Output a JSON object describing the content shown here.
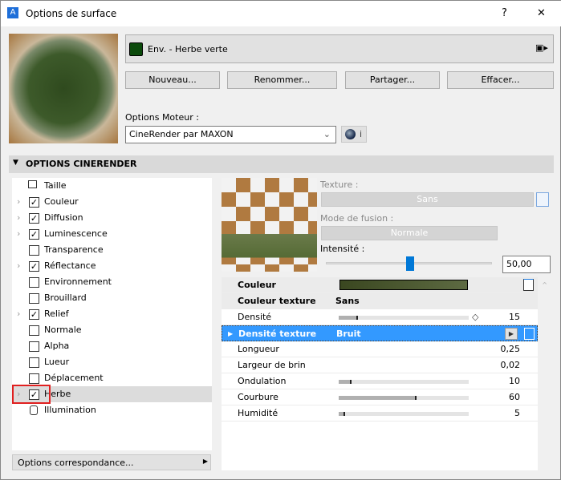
{
  "window": {
    "title": "Options de surface",
    "help": "?",
    "close": "✕"
  },
  "material": {
    "name": "Env. - Herbe verte",
    "swatch": "#0b4a0b"
  },
  "buttons": {
    "new": "Nouveau...",
    "rename": "Renommer...",
    "share": "Partager...",
    "delete": "Effacer..."
  },
  "engine": {
    "label": "Options Moteur :",
    "value": "CineRender par MAXON",
    "info": "i"
  },
  "section": {
    "title": "OPTIONS CINERENDER"
  },
  "channels": [
    {
      "label": "Taille",
      "type": "size"
    },
    {
      "label": "Couleur",
      "checked": true,
      "expand": true
    },
    {
      "label": "Diffusion",
      "checked": true,
      "expand": true
    },
    {
      "label": "Luminescence",
      "checked": true,
      "expand": true
    },
    {
      "label": "Transparence",
      "checked": false,
      "expand": false
    },
    {
      "label": "Réflectance",
      "checked": true,
      "expand": true
    },
    {
      "label": "Environnement",
      "checked": false,
      "expand": false
    },
    {
      "label": "Brouillard",
      "checked": false,
      "expand": false
    },
    {
      "label": "Relief",
      "checked": true,
      "expand": true
    },
    {
      "label": "Normale",
      "checked": false,
      "expand": false
    },
    {
      "label": "Alpha",
      "checked": false,
      "expand": false
    },
    {
      "label": "Lueur",
      "checked": false,
      "expand": false
    },
    {
      "label": "Déplacement",
      "checked": false,
      "expand": false
    },
    {
      "label": "Herbe",
      "checked": true,
      "expand": true,
      "selected": true
    },
    {
      "label": "Illumination",
      "type": "lock"
    }
  ],
  "matching": {
    "label": "Options correspondance..."
  },
  "texture": {
    "label": "Texture :",
    "value": "Sans",
    "blend_label": "Mode de fusion :",
    "blend_value": "Normale",
    "intensity_label": "Intensité :",
    "intensity_value": "50,00",
    "intensity_percent": 50
  },
  "params": {
    "color": {
      "label": "Couleur"
    },
    "color_texture": {
      "label": "Couleur texture",
      "value": "Sans"
    },
    "density": {
      "label": "Densité",
      "value": "15",
      "pct": 15
    },
    "density_texture": {
      "label": "Densité texture",
      "value": "Bruit"
    },
    "length": {
      "label": "Longueur",
      "value": "0,25"
    },
    "width": {
      "label": "Largeur de brin",
      "value": "0,02"
    },
    "waviness": {
      "label": "Ondulation",
      "value": "10",
      "pct": 10
    },
    "bend": {
      "label": "Courbure",
      "value": "60",
      "pct": 60
    },
    "humidity": {
      "label": "Humidité",
      "value": "5",
      "pct": 5
    }
  }
}
